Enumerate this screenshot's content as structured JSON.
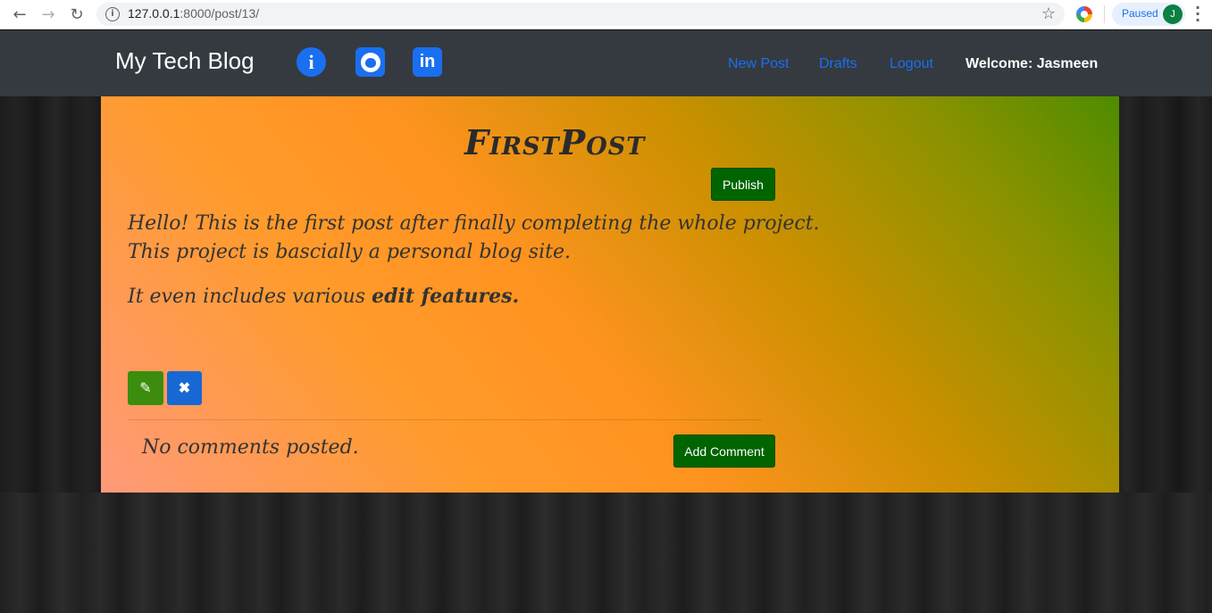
{
  "browser": {
    "url_host": "127.0.0.1",
    "url_rest": ":8000/post/13/",
    "profile_status": "Paused",
    "profile_initial": "J"
  },
  "site": {
    "brand": "My Tech Blog",
    "social_icons": [
      "info-icon",
      "github-icon",
      "linkedin-icon"
    ],
    "nav_links": [
      "New Post",
      "Drafts",
      "Logout"
    ],
    "welcome": "Welcome: Jasmeen"
  },
  "post": {
    "title": "FirstPost",
    "publish_label": "Publish",
    "line1": "Hello! This is the first post after finally completing the whole project.",
    "line2": "This project is bascially a personal blog site.",
    "line3_plain": "It even includes various ",
    "line3_bold": "edit features.",
    "no_comments": "No comments posted.",
    "add_comment_label": "Add Comment"
  },
  "colors": {
    "navbar": "#343a40",
    "link": "#1a6ff0",
    "publish_button": "#006400",
    "edit_button": "#3c8d0d",
    "delete_button": "#1868d4"
  }
}
